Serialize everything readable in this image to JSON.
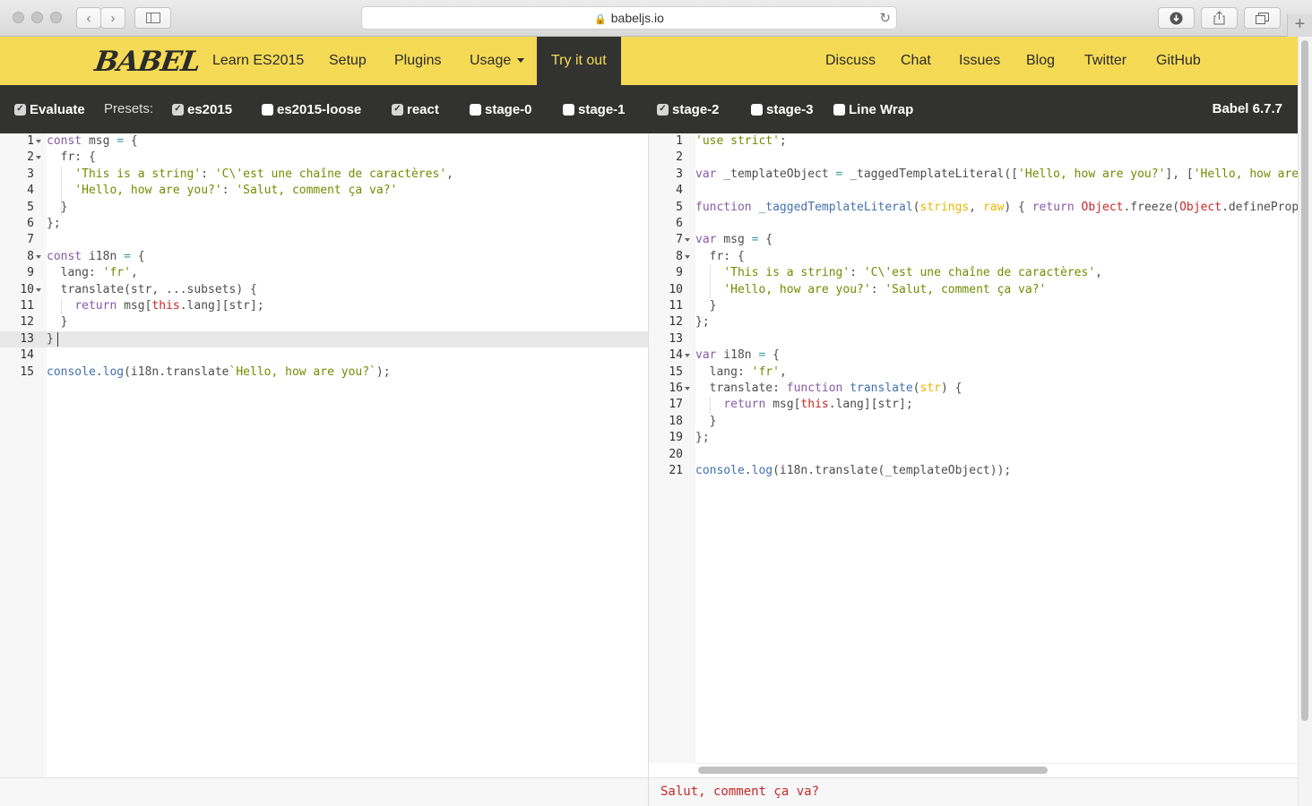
{
  "browser": {
    "url": "babeljs.io",
    "icons": [
      "back-icon",
      "forward-icon",
      "sidebar-icon",
      "lock-icon",
      "reload-icon",
      "download-icon",
      "share-icon",
      "tabs-icon",
      "new-tab-icon"
    ]
  },
  "header": {
    "logo": "BABEL",
    "nav_left": [
      "Learn ES2015",
      "Setup",
      "Plugins",
      "Usage",
      "Try it out"
    ],
    "nav_right": [
      "Discuss",
      "Chat",
      "Issues",
      "Blog",
      "Twitter",
      "GitHub"
    ],
    "active": "Try it out",
    "colors": {
      "brand_yellow": "#f5da55",
      "dark": "#323330"
    }
  },
  "options": {
    "evaluate": {
      "label": "Evaluate",
      "checked": true
    },
    "presets_label": "Presets:",
    "presets": [
      {
        "label": "es2015",
        "checked": true
      },
      {
        "label": "es2015-loose",
        "checked": false
      },
      {
        "label": "react",
        "checked": true
      },
      {
        "label": "stage-0",
        "checked": false
      },
      {
        "label": "stage-1",
        "checked": false
      },
      {
        "label": "stage-2",
        "checked": true
      },
      {
        "label": "stage-3",
        "checked": false
      }
    ],
    "line_wrap": {
      "label": "Line Wrap",
      "checked": false
    },
    "version": "Babel 6.7.7"
  },
  "input_editor": {
    "lines": [
      "const msg = {",
      "  fr: {",
      "    'This is a string': 'C\\'est une chaîne de caractères',",
      "    'Hello, how are you?': 'Salut, comment ça va?'",
      "  }",
      "};",
      "",
      "const i18n = {",
      "  lang: 'fr',",
      "  translate(str, ...subsets) {",
      "    return msg[this.lang][str];",
      "  }",
      "}",
      "",
      "console.log(i18n.translate`Hello, how are you?`);"
    ],
    "active_line": 13
  },
  "output_editor": {
    "lines": [
      "'use strict';",
      "",
      "var _templateObject = _taggedTemplateLiteral(['Hello, how are you?'], ['Hello, how are",
      "",
      "function _taggedTemplateLiteral(strings, raw) { return Object.freeze(Object.defineProp",
      "",
      "var msg = {",
      "  fr: {",
      "    'This is a string': 'C\\'est une chaîne de caractères',",
      "    'Hello, how are you?': 'Salut, comment ça va?'",
      "  }",
      "};",
      "",
      "var i18n = {",
      "  lang: 'fr',",
      "  translate: function translate(str) {",
      "    return msg[this.lang][str];",
      "  }",
      "};",
      "",
      "console.log(i18n.translate(_templateObject));"
    ]
  },
  "console_output": "Salut, comment ça va?"
}
